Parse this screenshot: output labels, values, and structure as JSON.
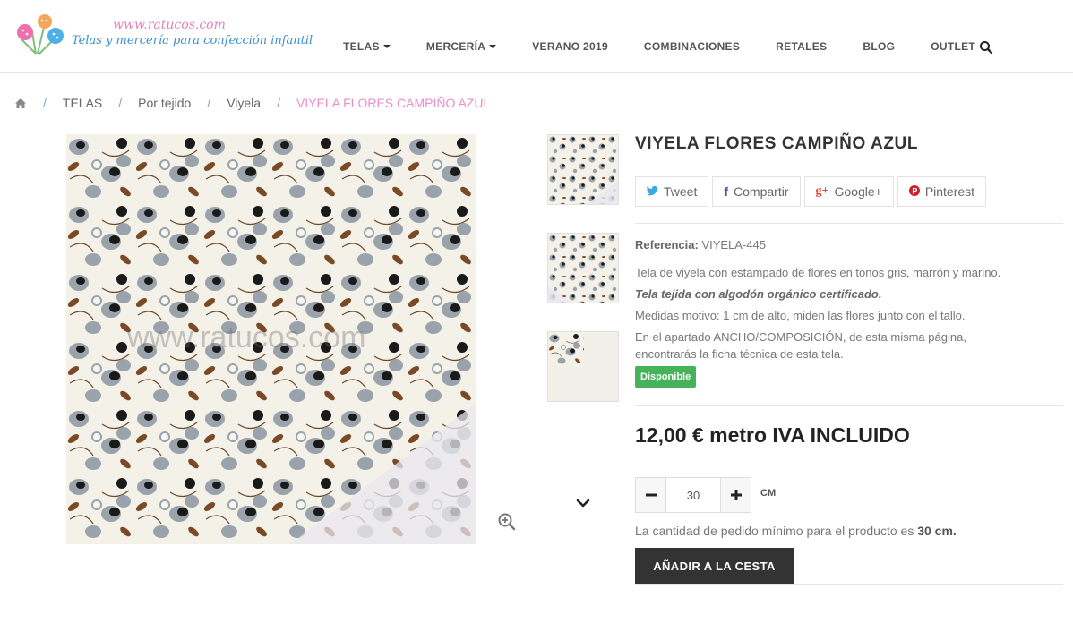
{
  "header": {
    "logo_url_text": "www.ratucos.com",
    "logo_tagline": "Telas y mercería para confección infantil",
    "nav": [
      {
        "label": "TELAS",
        "has_dropdown": true
      },
      {
        "label": "MERCERÍA",
        "has_dropdown": true
      },
      {
        "label": "VERANO 2019",
        "has_dropdown": false
      },
      {
        "label": "COMBINACIONES",
        "has_dropdown": false
      },
      {
        "label": "RETALES",
        "has_dropdown": false
      },
      {
        "label": "BLOG",
        "has_dropdown": false
      },
      {
        "label": "OUTLET",
        "has_dropdown": false
      }
    ],
    "search_icon": "search-icon"
  },
  "breadcrumb": {
    "home_icon": "home-icon",
    "sep": "/",
    "items": [
      "TELAS",
      "Por tejido",
      "Viyela"
    ],
    "current": "VIYELA FLORES CAMPIÑO AZUL"
  },
  "gallery": {
    "watermark": "www.ratucos.com",
    "zoom_icon": "zoom-in-icon",
    "next_icon": "chevron-down-icon"
  },
  "product": {
    "title": "VIYELA FLORES CAMPIÑO AZUL",
    "share": [
      {
        "icon": "twitter-icon",
        "glyph": "🐦",
        "label": "Tweet"
      },
      {
        "icon": "facebook-icon",
        "glyph": "f",
        "label": "Compartir"
      },
      {
        "icon": "google-plus-icon",
        "glyph": "g+",
        "label": "Google+"
      },
      {
        "icon": "pinterest-icon",
        "glyph": "P",
        "label": "Pinterest"
      }
    ],
    "ref_label": "Referencia:",
    "ref_value": "VIYELA-445",
    "desc_1": "Tela de viyela con estampado de flores en tonos gris, marrón y marino.",
    "desc_2": "Tela tejida con algodón orgánico certificado.",
    "desc_3": "Medidas motivo: 1 cm de alto, miden las flores junto con el tallo.",
    "desc_4": "En el apartado ANCHO/COMPOSICIÓN, de esta misma página,",
    "desc_5": "encontrarás la ficha técnica de esta tela.",
    "availability": "Disponible",
    "price": "12,00 € metro IVA INCLUIDO",
    "qty_value": "30",
    "qty_unit": "CM",
    "min_note_prefix": "La cantidad de pedido mínimo para el producto es ",
    "min_note_value": "30 cm.",
    "add_to_cart": "AÑADIR A LA CESTA"
  },
  "colors": {
    "accent_pink": "#f08cc8",
    "link_blue": "#7aa6d8",
    "available_green": "#46b35a",
    "button_dark": "#333333"
  }
}
